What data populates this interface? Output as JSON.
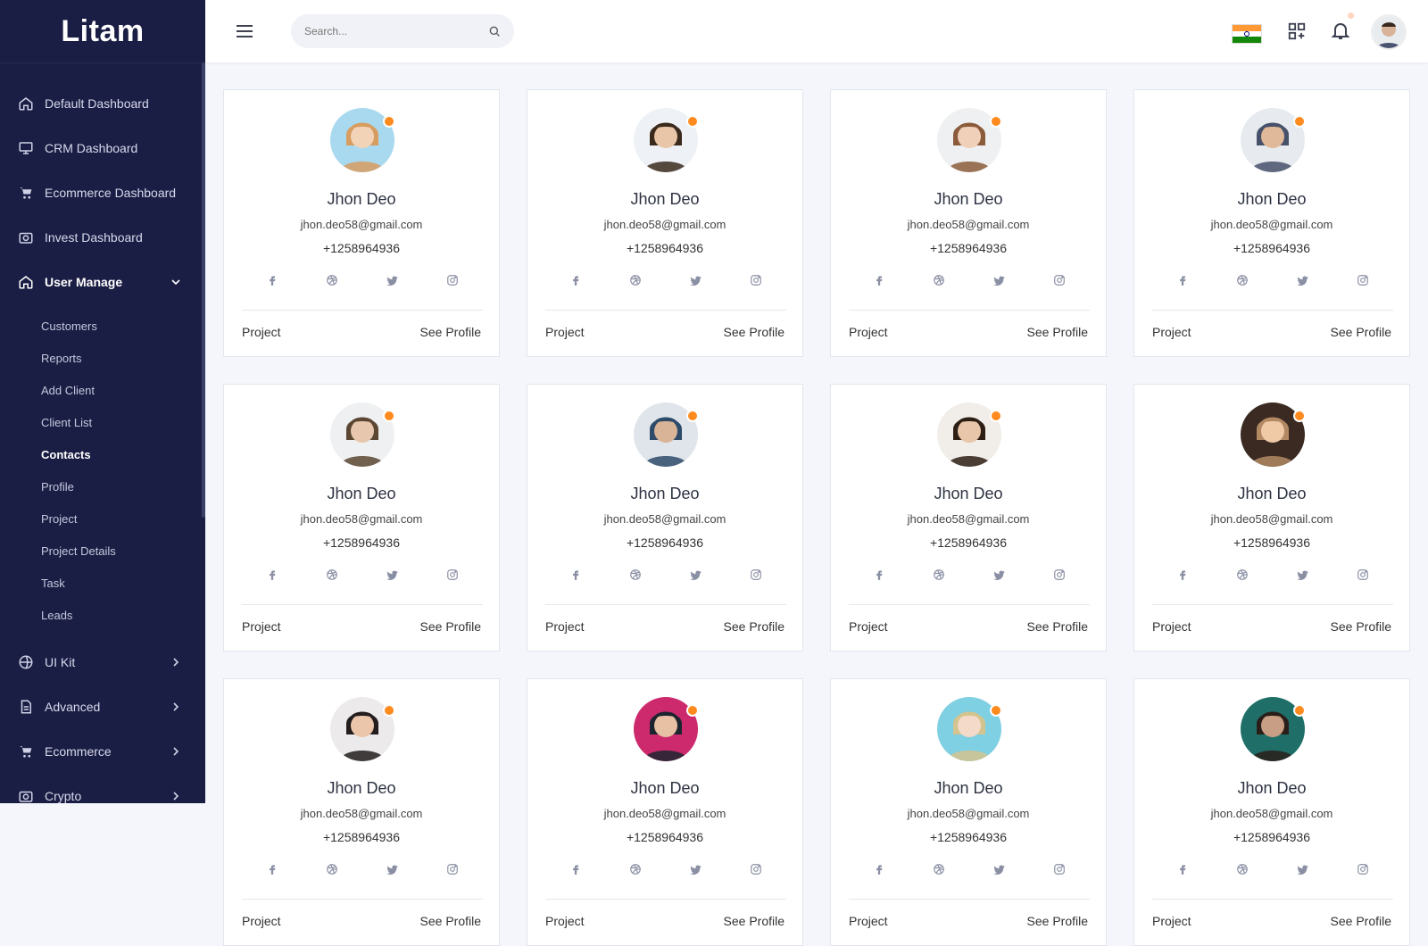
{
  "app": {
    "logo": "Litam"
  },
  "sidebar": {
    "items": [
      {
        "label": "Default Dashboard",
        "icon": "home-icon"
      },
      {
        "label": "CRM Dashboard",
        "icon": "monitor-icon"
      },
      {
        "label": "Ecommerce Dashboard",
        "icon": "cart-icon"
      },
      {
        "label": "Invest Dashboard",
        "icon": "camera-icon"
      },
      {
        "label": "User Manage",
        "icon": "home-icon",
        "expanded": true
      }
    ],
    "submenu": [
      "Customers",
      "Reports",
      "Add Client",
      "Client List",
      "Contacts",
      "Profile",
      "Project",
      "Project Details",
      "Task",
      "Leads"
    ],
    "bottom_items": [
      {
        "label": "UI Kit",
        "icon": "globe-icon"
      },
      {
        "label": "Advanced",
        "icon": "document-icon"
      },
      {
        "label": "Ecommerce",
        "icon": "cart-icon"
      },
      {
        "label": "Crypto",
        "icon": "camera-icon"
      }
    ],
    "current_submenu": "Contacts"
  },
  "header": {
    "search_placeholder": "Search...",
    "flag": "india-flag"
  },
  "contacts": [
    {
      "name": "Jhon Deo",
      "email": "jhon.deo58@gmail.com",
      "phone": "+1258964936",
      "project": "Project",
      "profile": "See Profile",
      "avatar_colors": [
        "#a9d9ef",
        "#f2d3b7",
        "#d79c60"
      ]
    },
    {
      "name": "Jhon Deo",
      "email": "jhon.deo58@gmail.com",
      "phone": "+1258964936",
      "project": "Project",
      "profile": "See Profile",
      "avatar_colors": [
        "#eef2f6",
        "#e8c6a7",
        "#3a2a1c"
      ]
    },
    {
      "name": "Jhon Deo",
      "email": "jhon.deo58@gmail.com",
      "phone": "+1258964936",
      "project": "Project",
      "profile": "See Profile",
      "avatar_colors": [
        "#eef0f2",
        "#f0d0b8",
        "#8b5c3b"
      ]
    },
    {
      "name": "Jhon Deo",
      "email": "jhon.deo58@gmail.com",
      "phone": "+1258964936",
      "project": "Project",
      "profile": "See Profile",
      "avatar_colors": [
        "#e7ebef",
        "#dfb999",
        "#47516a"
      ]
    },
    {
      "name": "Jhon Deo",
      "email": "jhon.deo58@gmail.com",
      "phone": "+1258964936",
      "project": "Project",
      "profile": "See Profile",
      "avatar_colors": [
        "#eef0f2",
        "#e7c7ad",
        "#5c4733"
      ]
    },
    {
      "name": "Jhon Deo",
      "email": "jhon.deo58@gmail.com",
      "phone": "+1258964936",
      "project": "Project",
      "profile": "See Profile",
      "avatar_colors": [
        "#dfe5ea",
        "#d9b497",
        "#2f4b6a"
      ]
    },
    {
      "name": "Jhon Deo",
      "email": "jhon.deo58@gmail.com",
      "phone": "+1258964936",
      "project": "Project",
      "profile": "See Profile",
      "avatar_colors": [
        "#f1ede8",
        "#e7c6aa",
        "#2e1f14"
      ]
    },
    {
      "name": "Jhon Deo",
      "email": "jhon.deo58@gmail.com",
      "phone": "+1258964936",
      "project": "Project",
      "profile": "See Profile",
      "avatar_colors": [
        "#3a2a22",
        "#f0c9a6",
        "#b28963"
      ]
    },
    {
      "name": "Jhon Deo",
      "email": "jhon.deo58@gmail.com",
      "phone": "+1258964936",
      "project": "Project",
      "profile": "See Profile",
      "avatar_colors": [
        "#eceaea",
        "#ecc6ab",
        "#231d1d"
      ]
    },
    {
      "name": "Jhon Deo",
      "email": "jhon.deo58@gmail.com",
      "phone": "+1258964936",
      "project": "Project",
      "profile": "See Profile",
      "avatar_colors": [
        "#cc2a6c",
        "#e8c0a4",
        "#1c2430"
      ]
    },
    {
      "name": "Jhon Deo",
      "email": "jhon.deo58@gmail.com",
      "phone": "+1258964936",
      "project": "Project",
      "profile": "See Profile",
      "avatar_colors": [
        "#7fd0e2",
        "#f4dac8",
        "#d3c38e"
      ]
    },
    {
      "name": "Jhon Deo",
      "email": "jhon.deo58@gmail.com",
      "phone": "+1258964936",
      "project": "Project",
      "profile": "See Profile",
      "avatar_colors": [
        "#1f6f68",
        "#c89f84",
        "#2a1e1a"
      ]
    }
  ],
  "colors": {
    "sidebar_bg": "#1b1e44",
    "accent_status": "#ff8a1e",
    "page_bg": "#f4f6fb"
  }
}
